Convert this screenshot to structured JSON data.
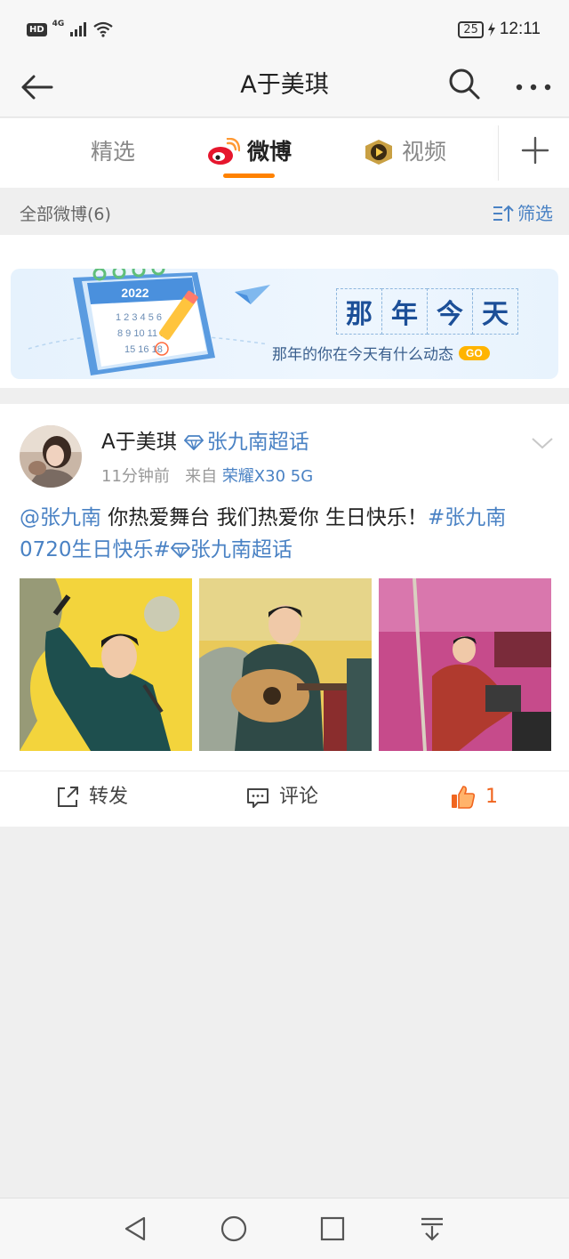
{
  "status_bar": {
    "hd": "HD",
    "network": "4G",
    "battery": "25",
    "time": "12:11"
  },
  "header": {
    "title": "A于美琪"
  },
  "tabs": [
    {
      "label": "精选"
    },
    {
      "label": "微博"
    },
    {
      "label": "视频"
    }
  ],
  "filter": {
    "count_label": "全部微博(6)",
    "filter_label": "筛选"
  },
  "banner": {
    "title_chars": [
      "那",
      "年",
      "今",
      "天"
    ],
    "subtitle": "那年的你在今天有什么动态",
    "go": "GO",
    "calendar_year": "2022"
  },
  "post": {
    "author": "A于美琪",
    "topic": "张九南超话",
    "time": "11分钟前",
    "source_prefix": "来自",
    "source": "荣耀X30 5G",
    "mention": "@张九南",
    "body": " 你热爱舞台  我们热爱你  生日快乐！",
    "hashtag": "#张九南0720生日快乐#",
    "topic_inline": "张九南超话",
    "actions": {
      "repost": "转发",
      "comment": "评论",
      "like_count": "1"
    }
  },
  "colors": {
    "link": "#4a82c4",
    "accent": "#ff8200",
    "like": "#f0651f"
  }
}
